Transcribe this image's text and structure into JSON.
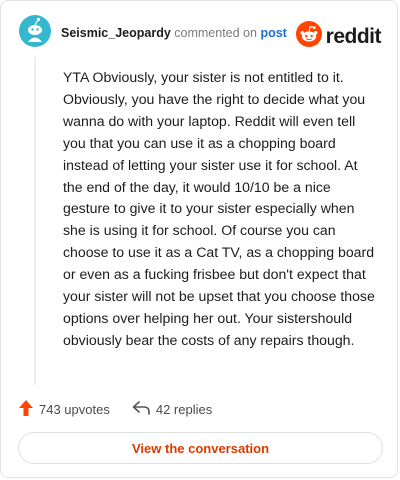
{
  "comment": {
    "author": "Seismic_Jeopardy",
    "action_text": "commented on",
    "target_link": "post",
    "body": "YTA Obviously, your sister is not entitled to it. Obviously, you have the right to decide what you wanna do with your laptop. Reddit will even tell you that you can use it as a chopping board instead of letting your sister use it for school. At the end of the day, it would 10/10 be a nice gesture to give it to your sister especially when she is using it for school. Of course you can choose to use it as a Cat TV, as a chopping board or even as a fucking frisbee but don't expect that your sister will not be upset that you choose those options over helping her out. Your sistershould obviously bear the costs of any repairs though.",
    "avatar_icon": "snoo-avatar-icon",
    "avatar_color": "#35b7d0"
  },
  "brand": {
    "name": "reddit",
    "logo_icon": "reddit-logo-icon",
    "color": "#ff4500"
  },
  "actions": {
    "upvotes_label": "743 upvotes",
    "upvote_icon": "upvote-arrow-icon",
    "upvote_color": "#ff4500",
    "replies_label": "42 replies",
    "reply_icon": "reply-arrow-icon"
  },
  "footer": {
    "button_label": "View the conversation",
    "button_color": "#d93a00"
  }
}
